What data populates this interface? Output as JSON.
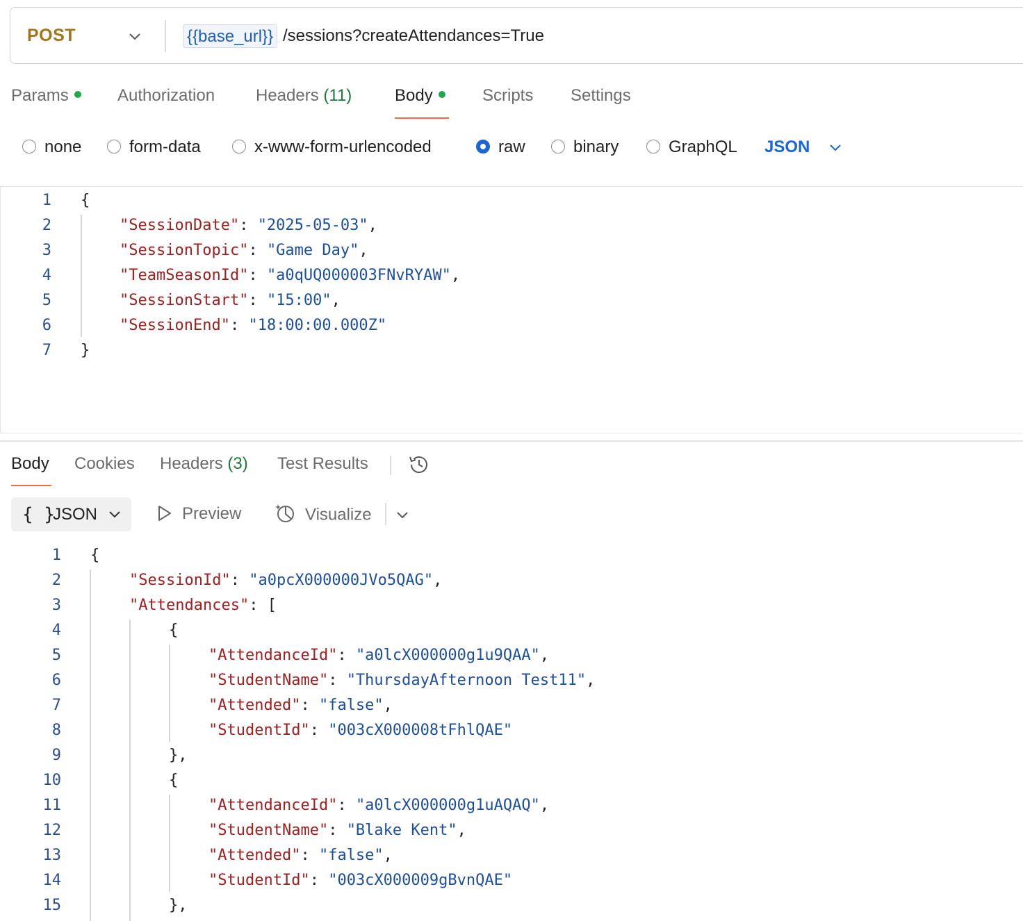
{
  "request": {
    "method": "POST",
    "url_variable": "{{base_url}}",
    "url_path": "/sessions?createAttendances=True",
    "tabs": [
      {
        "label": "Params"
      },
      {
        "label": "Authorization"
      },
      {
        "label": "Headers",
        "count": "(11)"
      },
      {
        "label": "Body"
      },
      {
        "label": "Scripts"
      },
      {
        "label": "Settings"
      }
    ],
    "active_tab": "Body",
    "body_types": [
      "none",
      "form-data",
      "x-www-form-urlencoded",
      "raw",
      "binary",
      "GraphQL"
    ],
    "selected_body_type": "raw",
    "format": "JSON",
    "line_numbers": [
      "1",
      "2",
      "3",
      "4",
      "5",
      "6",
      "7"
    ],
    "code": {
      "open": "{",
      "close": "}",
      "fields": [
        {
          "key": "\"SessionDate\"",
          "value": "\"2025-05-03\""
        },
        {
          "key": "\"SessionTopic\"",
          "value": "\"Game Day\""
        },
        {
          "key": "\"TeamSeasonId\"",
          "value": "\"a0qUQ000003FNvRYAW\""
        },
        {
          "key": "\"SessionStart\"",
          "value": "\"15:00\""
        },
        {
          "key": "\"SessionEnd\"",
          "value": "\"18:00:00.000Z\""
        }
      ]
    }
  },
  "response": {
    "tabs": [
      {
        "label": "Body"
      },
      {
        "label": "Cookies"
      },
      {
        "label": "Headers",
        "count": "(3)"
      },
      {
        "label": "Test Results"
      }
    ],
    "active_tab": "Body",
    "toolbar": {
      "format_braces": "{ }",
      "format_label": "JSON",
      "preview_label": "Preview",
      "visualize_label": "Visualize"
    },
    "line_numbers": [
      "1",
      "2",
      "3",
      "4",
      "5",
      "6",
      "7",
      "8",
      "9",
      "10",
      "11",
      "12",
      "13",
      "14",
      "15"
    ],
    "code": {
      "open": "{",
      "session_key": "\"SessionId\"",
      "session_value": "\"a0pcX000000JVo5QAG\"",
      "att_key": "\"Attendances\"",
      "att_open": "[",
      "obj_open": "{",
      "obj_close": "},",
      "records": [
        {
          "AttendanceId": {
            "key": "\"AttendanceId\"",
            "value": "\"a0lcX000000g1u9QAA\""
          },
          "StudentName": {
            "key": "\"StudentName\"",
            "value": "\"ThursdayAfternoon Test11\""
          },
          "Attended": {
            "key": "\"Attended\"",
            "value": "\"false\""
          },
          "StudentId": {
            "key": "\"StudentId\"",
            "value": "\"003cX000008tFhlQAE\""
          }
        },
        {
          "AttendanceId": {
            "key": "\"AttendanceId\"",
            "value": "\"a0lcX000000g1uAQAQ\""
          },
          "StudentName": {
            "key": "\"StudentName\"",
            "value": "\"Blake Kent\""
          },
          "Attended": {
            "key": "\"Attended\"",
            "value": "\"false\""
          },
          "StudentId": {
            "key": "\"StudentId\"",
            "value": "\"003cX000009gBvnQAE\""
          }
        }
      ]
    }
  },
  "colors": {
    "method": "#a1751c",
    "accent_underline": "#f26b3a",
    "status_dot": "#1fa84a",
    "json_key": "#a02020",
    "json_string": "#1d4fa0",
    "selected_radio": "#1a66d8"
  },
  "icons": [
    "chevron-down-icon",
    "play-icon",
    "visualize-icon",
    "history-icon"
  ]
}
